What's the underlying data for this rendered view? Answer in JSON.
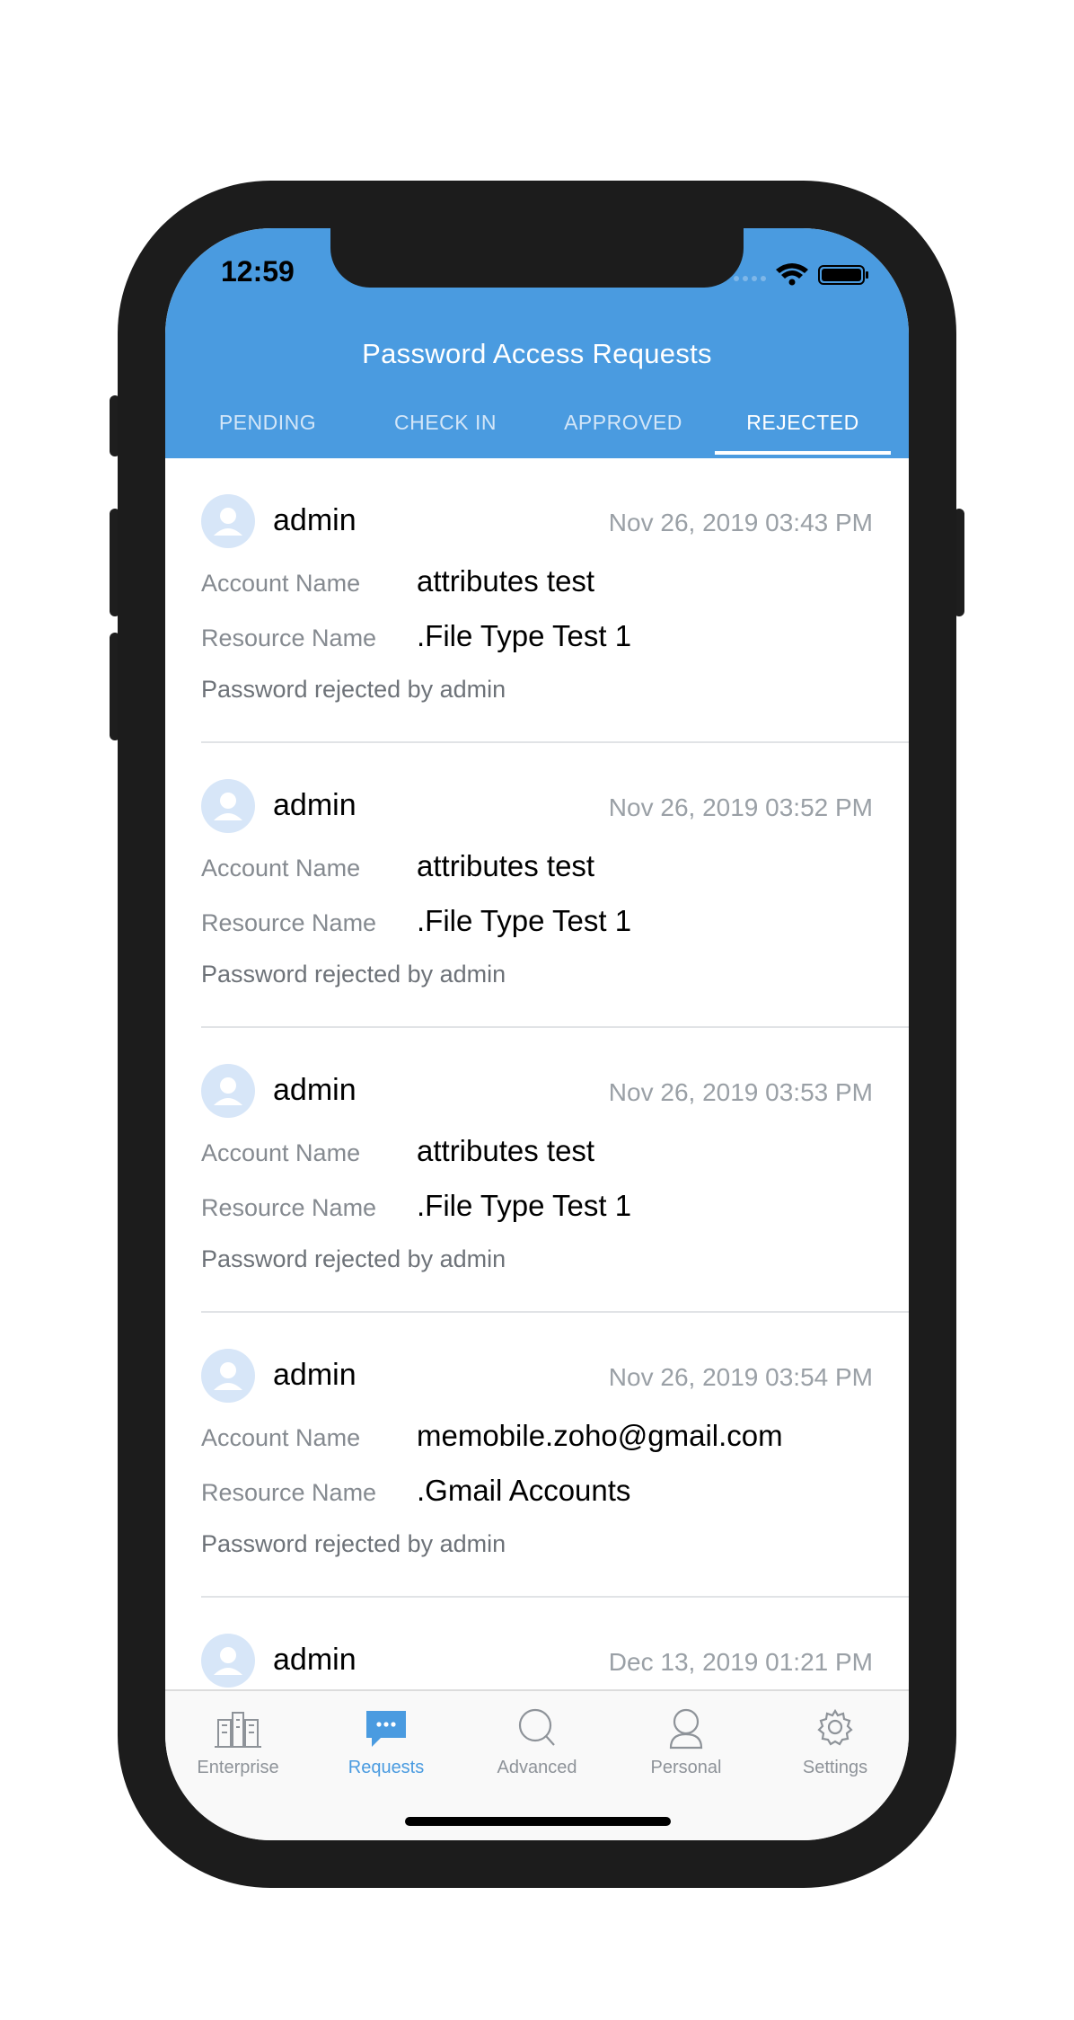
{
  "status_bar": {
    "time": "12:59"
  },
  "header": {
    "title": "Password Access Requests",
    "tabs": [
      {
        "label": "PENDING"
      },
      {
        "label": "CHECK IN"
      },
      {
        "label": "APPROVED"
      },
      {
        "label": "REJECTED"
      }
    ],
    "active_tab": "REJECTED"
  },
  "requests": [
    {
      "user": "admin",
      "date": "Nov 26, 2019 03:43 PM",
      "account_label": "Account Name",
      "account": "attributes test",
      "resource_label": "Resource Name",
      "resource": ".File Type Test 1",
      "status": "Password rejected by admin"
    },
    {
      "user": "admin",
      "date": "Nov 26, 2019 03:52 PM",
      "account_label": "Account Name",
      "account": "attributes test",
      "resource_label": "Resource Name",
      "resource": ".File Type Test 1",
      "status": "Password rejected by admin"
    },
    {
      "user": "admin",
      "date": "Nov 26, 2019 03:53 PM",
      "account_label": "Account Name",
      "account": "attributes test",
      "resource_label": "Resource Name",
      "resource": ".File Type Test 1",
      "status": "Password rejected by admin"
    },
    {
      "user": "admin",
      "date": "Nov 26, 2019 03:54 PM",
      "account_label": "Account Name",
      "account": "memobile.zoho@gmail.com",
      "resource_label": "Resource Name",
      "resource": ".Gmail Accounts",
      "status": "Password rejected by admin"
    },
    {
      "user": "admin",
      "date": "Dec 13, 2019 01:21 PM"
    }
  ],
  "tab_bar": [
    {
      "label": "Enterprise",
      "icon": "buildings-icon"
    },
    {
      "label": "Requests",
      "icon": "chat-bubble-icon"
    },
    {
      "label": "Advanced",
      "icon": "search-icon"
    },
    {
      "label": "Personal",
      "icon": "person-icon"
    },
    {
      "label": "Settings",
      "icon": "gear-icon"
    }
  ],
  "active_tab_bar": "Requests",
  "colors": {
    "accent": "#4a9be0",
    "avatar_bg": "#d7e6f8"
  }
}
